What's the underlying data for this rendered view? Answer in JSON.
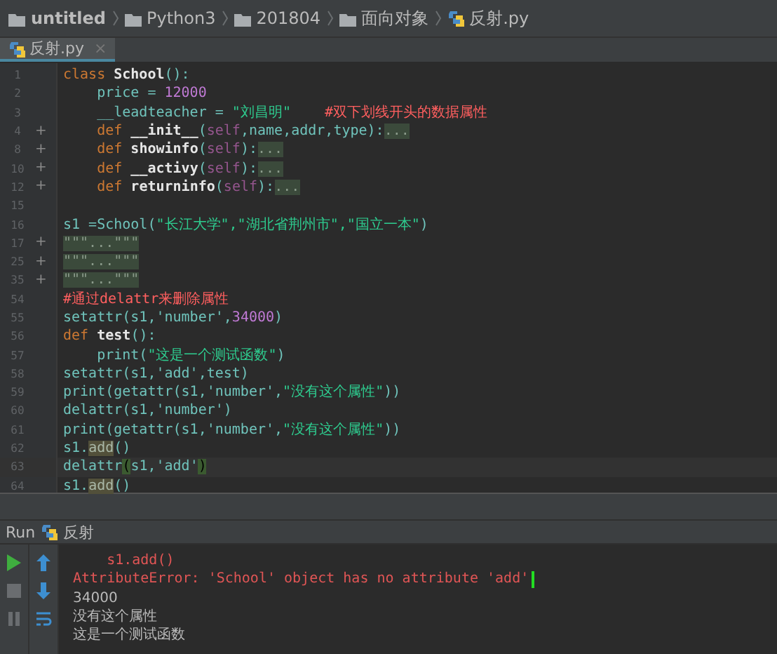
{
  "breadcrumbs": [
    {
      "label": "untitled",
      "kind": "project"
    },
    {
      "label": "Python3",
      "kind": "folder"
    },
    {
      "label": "201804",
      "kind": "folder"
    },
    {
      "label": "面向对象",
      "kind": "folder"
    },
    {
      "label": "反射.py",
      "kind": "file"
    }
  ],
  "tabs": [
    {
      "label": "反射.py",
      "close": "×",
      "selected": true
    }
  ],
  "lines": [
    {
      "number": "1",
      "tokens": [
        {
          "text": "class ",
          "kind": "kw"
        },
        {
          "text": "School",
          "kind": "def"
        },
        {
          "text": "():",
          "kind": "plain"
        }
      ]
    },
    {
      "number": "2",
      "tokens": [
        {
          "text": "    price = ",
          "kind": "plain"
        },
        {
          "text": "12000",
          "kind": "num"
        }
      ]
    },
    {
      "number": "3",
      "tokens": [
        {
          "text": "    __leadteacher = ",
          "kind": "plain"
        },
        {
          "text": "\"刘昌明\"",
          "kind": "str"
        },
        {
          "text": "    #双下划线开头的数据属性",
          "kind": "comment"
        }
      ]
    },
    {
      "number": "4",
      "fold": "+",
      "tokens": [
        {
          "text": "    def ",
          "kind": "kw"
        },
        {
          "text": "__init__",
          "kind": "def"
        },
        {
          "text": "(",
          "kind": "plain"
        },
        {
          "text": "self",
          "kind": "self"
        },
        {
          "text": ",name,addr,type):",
          "kind": "plain"
        },
        {
          "text": "...",
          "kind": "folded"
        }
      ]
    },
    {
      "number": "8",
      "fold": "+",
      "tokens": [
        {
          "text": "    def ",
          "kind": "kw"
        },
        {
          "text": "showinfo",
          "kind": "def"
        },
        {
          "text": "(",
          "kind": "plain"
        },
        {
          "text": "self",
          "kind": "self"
        },
        {
          "text": "):",
          "kind": "plain"
        },
        {
          "text": "...",
          "kind": "folded"
        }
      ]
    },
    {
      "number": "10",
      "fold": "+",
      "tokens": [
        {
          "text": "    def ",
          "kind": "kw"
        },
        {
          "text": "__activy",
          "kind": "def"
        },
        {
          "text": "(",
          "kind": "plain"
        },
        {
          "text": "self",
          "kind": "self"
        },
        {
          "text": "):",
          "kind": "plain"
        },
        {
          "text": "...",
          "kind": "folded"
        }
      ]
    },
    {
      "number": "12",
      "fold": "+",
      "tokens": [
        {
          "text": "    def ",
          "kind": "kw"
        },
        {
          "text": "returninfo",
          "kind": "def"
        },
        {
          "text": "(",
          "kind": "plain"
        },
        {
          "text": "self",
          "kind": "self"
        },
        {
          "text": "):",
          "kind": "plain"
        },
        {
          "text": "...",
          "kind": "folded"
        }
      ]
    },
    {
      "number": "15"
    },
    {
      "number": "16",
      "tokens": [
        {
          "text": "s1 =School(",
          "kind": "plain"
        },
        {
          "text": "\"长江大学\",\"湖北省荆州市\",\"国立一本\"",
          "kind": "str"
        },
        {
          "text": ")",
          "kind": "plain"
        }
      ]
    },
    {
      "number": "17",
      "fold": "+",
      "tokens": [
        {
          "text": "\"\"\"...\"\"\"",
          "kind": "folded"
        }
      ]
    },
    {
      "number": "25",
      "fold": "+",
      "tokens": [
        {
          "text": "\"\"\"...\"\"\"",
          "kind": "folded"
        }
      ]
    },
    {
      "number": "35",
      "fold": "+",
      "tokens": [
        {
          "text": "\"\"\"...\"\"\"",
          "kind": "folded"
        }
      ]
    },
    {
      "number": "54",
      "tokens": [
        {
          "text": "#通过delattr来删除属性",
          "kind": "comment"
        }
      ]
    },
    {
      "number": "55",
      "tokens": [
        {
          "text": "setattr(s1,'number',",
          "kind": "plain"
        },
        {
          "text": "34000",
          "kind": "num"
        },
        {
          "text": ")",
          "kind": "plain"
        }
      ]
    },
    {
      "number": "56",
      "tokens": [
        {
          "text": "def ",
          "kind": "kw"
        },
        {
          "text": "test",
          "kind": "def"
        },
        {
          "text": "():",
          "kind": "plain"
        }
      ]
    },
    {
      "number": "57",
      "tokens": [
        {
          "text": "    print(",
          "kind": "plain"
        },
        {
          "text": "\"这是一个测试函数\"",
          "kind": "str"
        },
        {
          "text": ")",
          "kind": "plain"
        }
      ]
    },
    {
      "number": "58",
      "tokens": [
        {
          "text": "setattr(s1,'add',test)",
          "kind": "plain"
        }
      ]
    },
    {
      "number": "59",
      "tokens": [
        {
          "text": "print(getattr(s1,'number',",
          "kind": "plain"
        },
        {
          "text": "\"没有这个属性\"",
          "kind": "str"
        },
        {
          "text": "))",
          "kind": "plain"
        }
      ]
    },
    {
      "number": "60",
      "tokens": [
        {
          "text": "delattr(s1,'number')",
          "kind": "plain"
        }
      ]
    },
    {
      "number": "61",
      "tokens": [
        {
          "text": "print(getattr(s1,'number',",
          "kind": "plain"
        },
        {
          "text": "\"没有这个属性\"",
          "kind": "str"
        },
        {
          "text": "))",
          "kind": "plain"
        }
      ]
    },
    {
      "number": "62",
      "tokens": [
        {
          "text": "s1.",
          "kind": "plain"
        },
        {
          "text": "add",
          "kind": "warn"
        },
        {
          "text": "()",
          "kind": "plain"
        }
      ]
    },
    {
      "number": "63",
      "current": true,
      "tokens": [
        {
          "text": "delattr",
          "kind": "plain"
        },
        {
          "text": "(",
          "kind": "brace"
        },
        {
          "text": "s1,'add'",
          "kind": "plain"
        },
        {
          "text": ")",
          "kind": "brace"
        }
      ]
    },
    {
      "number": "64",
      "tokens": [
        {
          "text": "s1.",
          "kind": "plain"
        },
        {
          "text": "add",
          "kind": "warn"
        },
        {
          "text": "()",
          "kind": "plain"
        }
      ]
    }
  ],
  "run_panel": {
    "label": "Run",
    "config": "反射"
  },
  "console": [
    {
      "text": "    s1.add()",
      "kind": "error"
    },
    {
      "text": "AttributeError: 'School' object has no attribute 'add'",
      "kind": "error"
    },
    {
      "text": "34000",
      "kind": "output"
    },
    {
      "text": "没有这个属性",
      "kind": "output"
    },
    {
      "text": "这是一个测试函数",
      "kind": "output"
    }
  ]
}
